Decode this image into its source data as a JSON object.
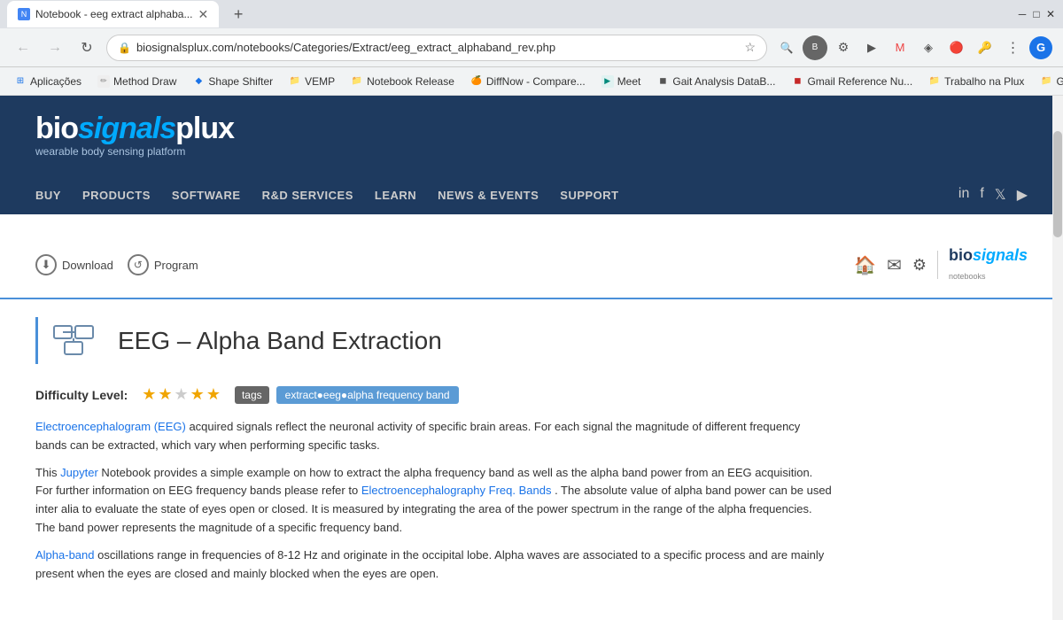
{
  "browser": {
    "tab": {
      "title": "Notebook - eeg extract alphaba...",
      "favicon_color": "#4285f4"
    },
    "url": "biosignalsplux.com/notebooks/Categories/Extract/eeg_extract_alphaband_rev.php",
    "profile_letter": "G"
  },
  "bookmarks": [
    {
      "label": "Aplicações",
      "icon": "⊞",
      "color": "#1a73e8"
    },
    {
      "label": "Method Draw",
      "icon": "✏",
      "color": "#888"
    },
    {
      "label": "Shape Shifter",
      "icon": "◆",
      "color": "#1a73e8"
    },
    {
      "label": "VEMP",
      "icon": "📁",
      "color": "#f9ab00"
    },
    {
      "label": "Notebook Release",
      "icon": "📁",
      "color": "#f9ab00"
    },
    {
      "label": "DiffNow - Compare...",
      "icon": "🍊",
      "color": "#ff6600"
    },
    {
      "label": "Meet",
      "icon": "◼",
      "color": "#00897b"
    },
    {
      "label": "Gait Analysis DataB...",
      "icon": "◼",
      "color": "#555"
    },
    {
      "label": "Gmail Reference Nu...",
      "icon": "◼",
      "color": "#c62828"
    },
    {
      "label": "Trabalho na Plux",
      "icon": "📁",
      "color": "#f9ab00"
    },
    {
      "label": "Games",
      "icon": "📁",
      "color": "#f9ab00"
    }
  ],
  "site": {
    "logo": {
      "part1": "bio",
      "part2": "signals",
      "part3": "plux",
      "tagline": "wearable body sensing platform"
    },
    "nav": [
      "BUY",
      "PRODUCTS",
      "SOFTWARE",
      "R&D SERVICES",
      "LEARN",
      "NEWS & EVENTS",
      "SUPPORT"
    ]
  },
  "notebook": {
    "toolbar": {
      "download_label": "Download",
      "program_label": "Program"
    },
    "page": {
      "title": "EEG – Alpha Band Extraction",
      "difficulty_label": "Difficulty Level:",
      "stars": [
        true,
        true,
        false,
        true,
        true
      ],
      "tags_label": "tags",
      "tags_value": "extract●eeg●alpha frequency band",
      "paragraph1_part1": "Electroencephalogram (EEG)",
      "paragraph1_link": "Electroencephalogram (EEG)",
      "paragraph1_rest": " acquired signals reflect the neuronal activity of specific brain areas. For each signal the magnitude of different frequency bands can be extracted, which vary when performing specific tasks.",
      "paragraph2": "This Jupyter Notebook provides a simple example on how to extract the alpha frequency band as well as the alpha band power from an EEG acquisition. For further information on EEG frequency bands please refer to ",
      "paragraph2_link": "Electroencephalography Freq. Bands",
      "paragraph2_rest": " . The absolute value of alpha band power can be used inter alia to evaluate the state of eyes open or closed. It is measured by integrating the area of the power spectrum in the range of the alpha frequencies. The band power represents the magnitude of a specific frequency band.",
      "paragraph3_link": "Alpha-band",
      "paragraph3_rest": " oscillations range in frequencies of 8-12 Hz and originate in the occipital lobe. Alpha waves are associated to a specific process and are mainly present when the eyes are closed and mainly blocked when the eyes are open."
    }
  }
}
